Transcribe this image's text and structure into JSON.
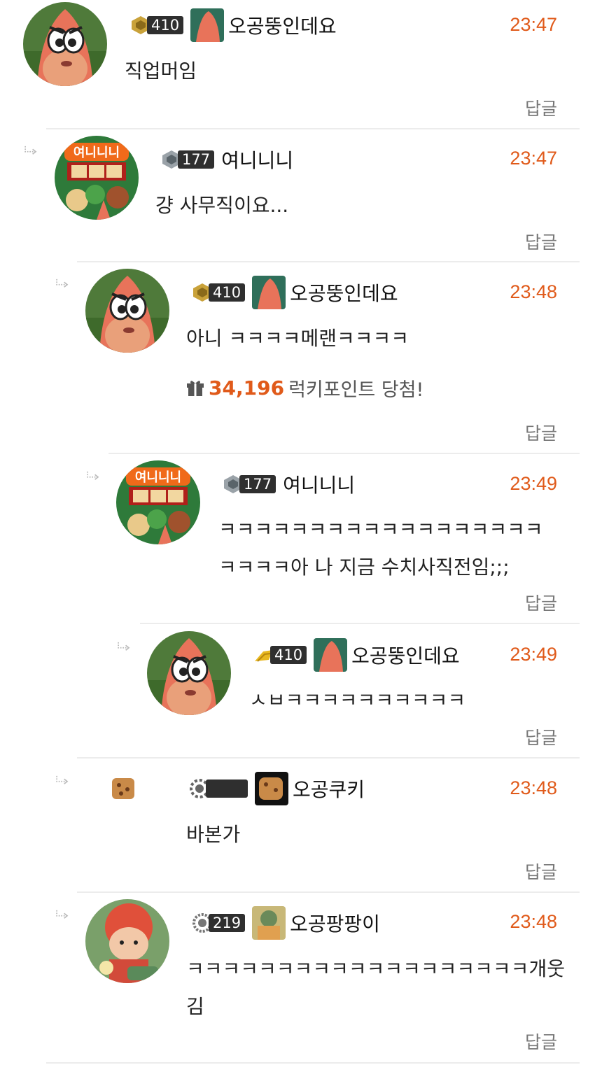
{
  "comments": [
    {
      "level": "410",
      "nickname": "오공뚱인데요",
      "time": "23:47",
      "lines": [
        "직업머임"
      ],
      "reply": "답글"
    },
    {
      "level": "177",
      "nickname": "여니니니",
      "time": "23:47",
      "lines": [
        "걍 사무직이요..."
      ],
      "reply": "답글"
    },
    {
      "level": "410",
      "nickname": "오공뚱인데요",
      "time": "23:48",
      "lines": [
        "아니 ㅋㅋㅋㅋ메랜ㅋㅋㅋㅋ"
      ],
      "reply": "답글",
      "lucky": {
        "points": "34,196",
        "label": "럭키포인트 당첨!"
      }
    },
    {
      "level": "177",
      "nickname": "여니니니",
      "time": "23:49",
      "lines": [
        "ㅋㅋㅋㅋㅋㅋㅋㅋㅋㅋㅋㅋㅋㅋㅋㅋㅋㅋ",
        "ㅋㅋㅋㅋ아 나 지금 수치사직전임;;;"
      ],
      "reply": "답글"
    },
    {
      "level": "410",
      "nickname": "오공뚱인데요",
      "time": "23:49",
      "lines": [
        "ㅅㅂㅋㅋㅋㅋㅋㅋㅋㅋㅋㅋ"
      ],
      "reply": "답글"
    },
    {
      "level": "",
      "nickname": "오공쿠키",
      "time": "23:48",
      "lines": [
        "바본가"
      ],
      "reply": "답글"
    },
    {
      "level": "219",
      "nickname": "오공팡팡이",
      "time": "23:48",
      "lines": [
        "ㅋㅋㅋㅋㅋㅋㅋㅋㅋㅋㅋㅋㅋㅋㅋㅋㅋㅋㅋ개웃",
        "김"
      ],
      "reply": "답글"
    }
  ],
  "colors": {
    "time": "#e05a1a",
    "divider": "#ececec",
    "badge": "#2f2f2f"
  }
}
